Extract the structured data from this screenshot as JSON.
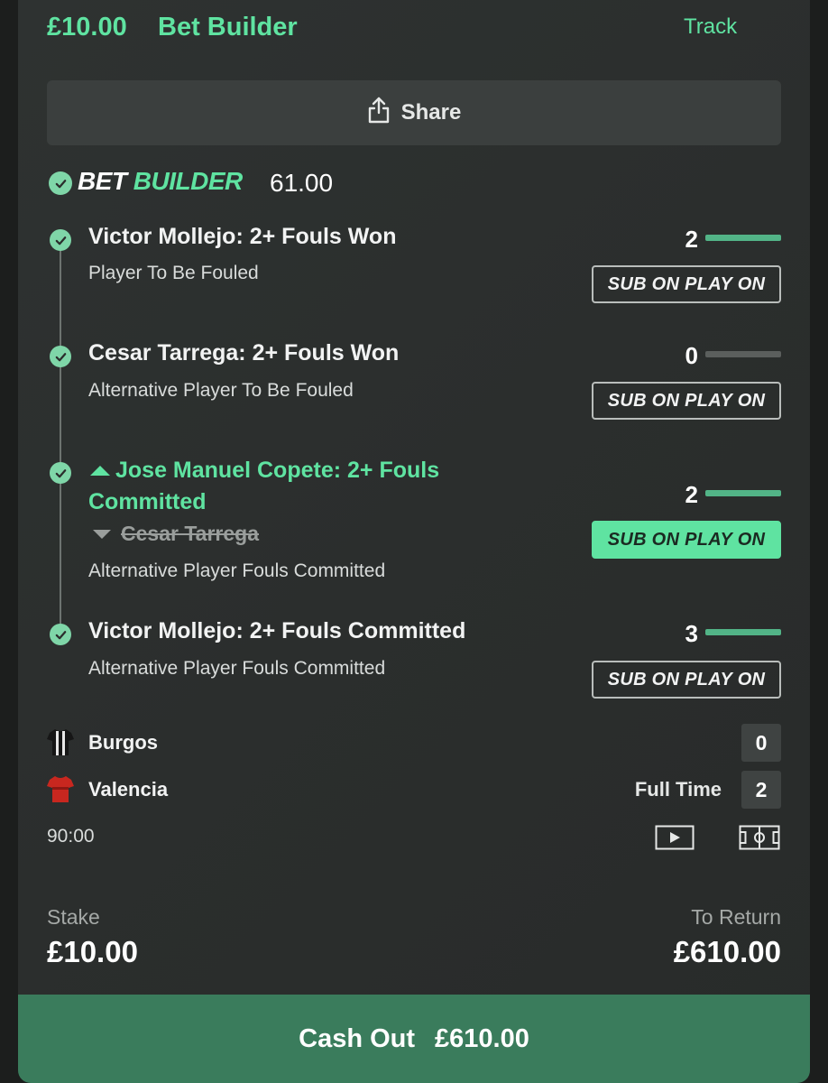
{
  "header": {
    "stake": "£10.00",
    "title": "Bet Builder",
    "track_label": "Track"
  },
  "share": {
    "label": "Share",
    "icon": "share-icon"
  },
  "bet_builder": {
    "logo_part1": "BET",
    "logo_part2": "BUILDER",
    "odds": "61.00"
  },
  "legs": [
    {
      "title": "Victor Mollejo: 2+ Fouls Won",
      "subtitle": "Player To Be Fouled",
      "count": "2",
      "progress": 1.0,
      "button": "SUB ON PLAY ON",
      "button_active": false
    },
    {
      "title": "Cesar Tarrega: 2+ Fouls Won",
      "subtitle": "Alternative Player To Be Fouled",
      "count": "0",
      "progress": 0.0,
      "button": "SUB ON PLAY ON",
      "button_active": false
    },
    {
      "title": "Jose Manuel Copete: 2+ Fouls Committed",
      "replaced": "Cesar Tarrega",
      "subtitle": "Alternative Player Fouls Committed",
      "count": "2",
      "progress": 1.0,
      "button": "SUB ON PLAY ON",
      "button_active": true
    },
    {
      "title": "Victor Mollejo: 2+ Fouls Committed",
      "subtitle": "Alternative Player Fouls Committed",
      "count": "3",
      "progress": 1.0,
      "button": "SUB ON PLAY ON",
      "button_active": false
    }
  ],
  "match": {
    "home": {
      "name": "Burgos",
      "score": "0"
    },
    "away": {
      "name": "Valencia",
      "score": "2"
    },
    "status": "Full Time",
    "clock": "90:00"
  },
  "footer": {
    "stake_label": "Stake",
    "stake_value": "£10.00",
    "return_label": "To Return",
    "return_value": "£610.00"
  },
  "cashout": {
    "label": "Cash Out",
    "amount": "£610.00"
  },
  "colors": {
    "accent": "#5fe3a1",
    "cashout_bg": "#3a7c5c",
    "progress": "#52b487"
  }
}
